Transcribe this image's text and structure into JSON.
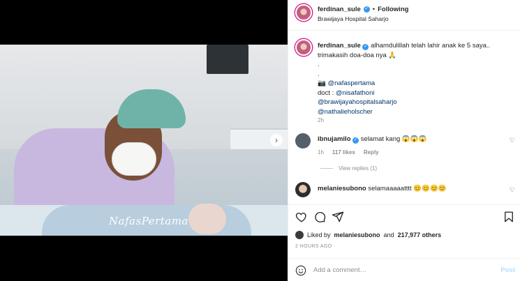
{
  "media": {
    "watermark": "NafasPertama",
    "next_icon": "chevron-right-icon"
  },
  "header": {
    "username": "ferdinan_sule",
    "separator": "•",
    "follow_label": "Following",
    "location": "Brawijaya Hospital Saharjo",
    "more_icon": "more-horizontal-icon"
  },
  "caption": {
    "username": "ferdinan_sule",
    "text_line1": "alhamdulillah telah lahir anak ke 5 saya..",
    "text_line2": "trimakasih doa-doa nya 🙏",
    "text_line3": ".",
    "text_line4": ".",
    "camera_emoji": "📷",
    "mention1": "@nafaspertama",
    "doct_label": "doct :",
    "mention2": "@nisafathoni",
    "mention3": "@brawijayahospitalsaharjo",
    "mention4": "@nathalieholscher",
    "time": "2h"
  },
  "comments": [
    {
      "username": "ibnujamilo",
      "text": "selamat kang 😱😱😱",
      "time": "1h",
      "likes": "117 likes",
      "reply": "Reply",
      "view_replies": "View replies (1)"
    },
    {
      "username": "melaniesubono",
      "text": "selamaaaaatttt 😊😊😊😊"
    }
  ],
  "actions": {
    "like_icon": "heart-icon",
    "comment_icon": "comment-icon",
    "share_icon": "share-icon",
    "save_icon": "bookmark-icon"
  },
  "likes": {
    "prefix": "Liked by",
    "user": "melaniesubono",
    "and": "and",
    "others": "217,977 others"
  },
  "time_ago": "2 HOURS AGO",
  "add_comment": {
    "placeholder": "Add a comment…",
    "post_label": "Post"
  },
  "colors": {
    "link": "#00376b",
    "verified": "#3897f0",
    "post_disabled": "#b2dffc"
  }
}
